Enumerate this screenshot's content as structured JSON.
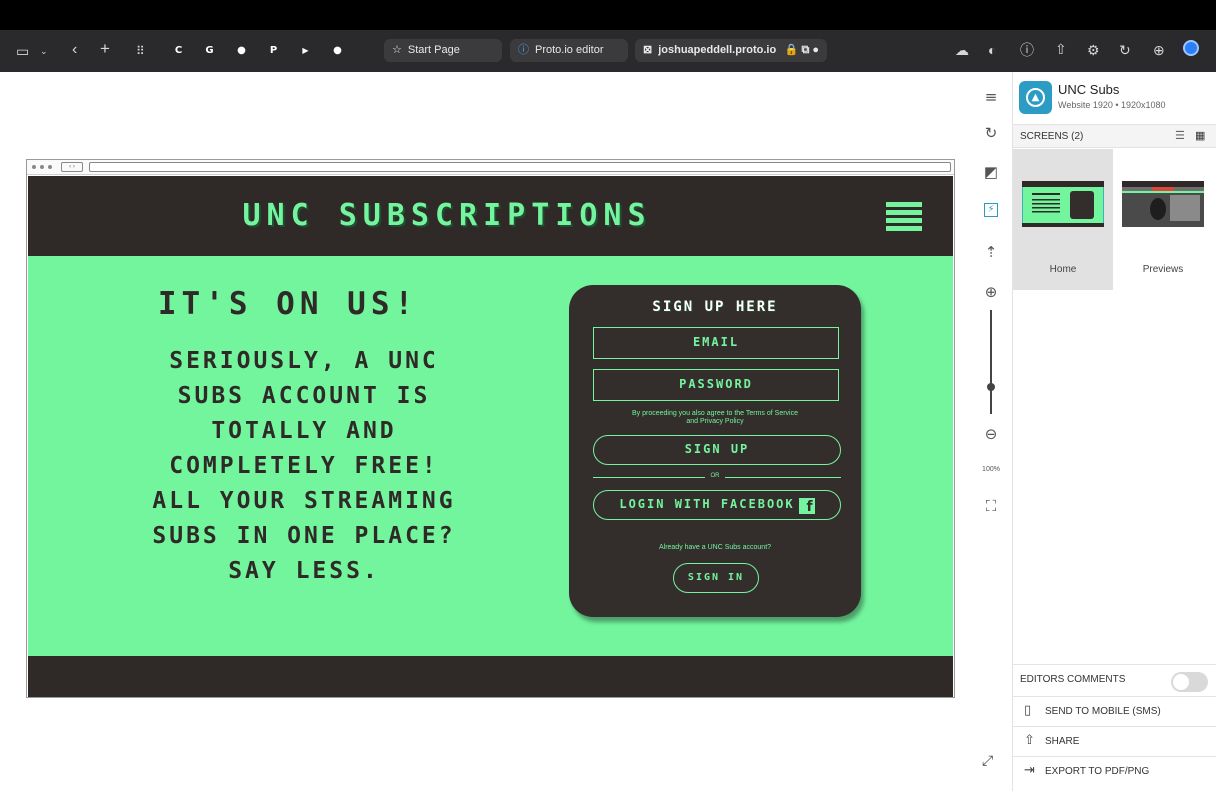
{
  "browser": {
    "extensions": [
      {
        "name": "c-extension-icon",
        "letter": "C",
        "color": "#8e8e93"
      },
      {
        "name": "grammarly-icon",
        "letter": "G",
        "color": "#15c39a"
      },
      {
        "name": "red-extension-icon",
        "letter": "●",
        "color": "#d0021b"
      },
      {
        "name": "p-extension-icon",
        "letter": "P",
        "color": "#8e8e93"
      },
      {
        "name": "youtube-icon",
        "letter": "▶",
        "color": "#ff0000"
      },
      {
        "name": "reddit-icon",
        "letter": "●",
        "color": "#ff4500"
      }
    ],
    "tabs": [
      {
        "icon": "☆",
        "label": "Start Page"
      },
      {
        "icon": "ⓘ",
        "label": "Proto.io editor"
      },
      {
        "icon": "⊠",
        "label": "joshuapeddell.proto.io"
      }
    ]
  },
  "site": {
    "title": "UNC SUBSCRIPTIONS",
    "headline": "IT'S ON US!",
    "blurb_lines": [
      "SERIOUSLY, A UNC",
      "SUBS ACCOUNT IS",
      "TOTALLY AND",
      "COMPLETELY FREE!",
      "ALL YOUR STREAMING",
      "SUBS IN ONE PLACE?",
      "SAY LESS."
    ],
    "signup": {
      "title": "SIGN UP HERE",
      "email_placeholder": "EMAIL",
      "password_placeholder": "PASSWORD",
      "terms_line1": "By proceeding you also agree to the Terms of Service",
      "terms_line2": "and Privacy Policy",
      "signup_button": "SIGN UP",
      "or_label": "OR",
      "facebook_button": "LOGIN WITH FACEBOOK",
      "already_text": "Already have a UNC Subs account?",
      "signin_button": "SIGN IN"
    },
    "colors": {
      "dark": "#2f2a27",
      "green": "#73f59e"
    }
  },
  "tools": {
    "zoom_level": "100%",
    "zoom_fraction": 0.74
  },
  "panel": {
    "project_name": "UNC Subs",
    "project_meta": "Website 1920 • 1920x1080",
    "screens_label": "SCREENS (2)",
    "screens": [
      {
        "name": "Home"
      },
      {
        "name": "Previews"
      }
    ],
    "comments_label": "EDITORS COMMENTS",
    "send_label": "SEND TO MOBILE (SMS)",
    "share_label": "SHARE",
    "export_label": "EXPORT TO PDF/PNG"
  }
}
